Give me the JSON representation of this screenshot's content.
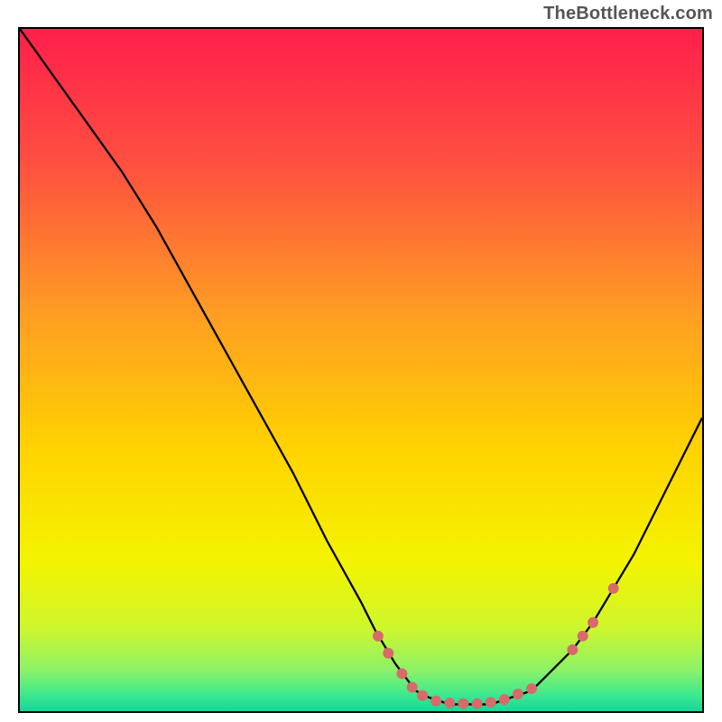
{
  "watermark": "TheBottleneck.com",
  "chart_data": {
    "type": "line",
    "title": "",
    "xlabel": "",
    "ylabel": "",
    "xlim": [
      0,
      100
    ],
    "ylim": [
      0,
      100
    ],
    "curve": [
      {
        "x": 0,
        "y": 100
      },
      {
        "x": 5,
        "y": 93
      },
      {
        "x": 10,
        "y": 86
      },
      {
        "x": 15,
        "y": 79
      },
      {
        "x": 20,
        "y": 71
      },
      {
        "x": 25,
        "y": 62
      },
      {
        "x": 30,
        "y": 53
      },
      {
        "x": 35,
        "y": 44
      },
      {
        "x": 40,
        "y": 35
      },
      {
        "x": 45,
        "y": 25
      },
      {
        "x": 50,
        "y": 16
      },
      {
        "x": 52,
        "y": 12
      },
      {
        "x": 55,
        "y": 7
      },
      {
        "x": 58,
        "y": 3
      },
      {
        "x": 60,
        "y": 2
      },
      {
        "x": 63,
        "y": 1
      },
      {
        "x": 66,
        "y": 1
      },
      {
        "x": 69,
        "y": 1
      },
      {
        "x": 72,
        "y": 2
      },
      {
        "x": 75,
        "y": 3
      },
      {
        "x": 78,
        "y": 6
      },
      {
        "x": 81,
        "y": 9
      },
      {
        "x": 84,
        "y": 13
      },
      {
        "x": 87,
        "y": 18
      },
      {
        "x": 90,
        "y": 23
      },
      {
        "x": 93,
        "y": 29
      },
      {
        "x": 96,
        "y": 35
      },
      {
        "x": 100,
        "y": 43
      }
    ],
    "markers": [
      {
        "x": 52.5,
        "y": 11
      },
      {
        "x": 54,
        "y": 8.5
      },
      {
        "x": 56,
        "y": 5.5
      },
      {
        "x": 57.5,
        "y": 3.5
      },
      {
        "x": 59,
        "y": 2.3
      },
      {
        "x": 61,
        "y": 1.5
      },
      {
        "x": 63,
        "y": 1.2
      },
      {
        "x": 65,
        "y": 1.1
      },
      {
        "x": 67,
        "y": 1.1
      },
      {
        "x": 69,
        "y": 1.3
      },
      {
        "x": 71,
        "y": 1.7
      },
      {
        "x": 73,
        "y": 2.5
      },
      {
        "x": 75,
        "y": 3.3
      },
      {
        "x": 81,
        "y": 9
      },
      {
        "x": 82.5,
        "y": 11
      },
      {
        "x": 84,
        "y": 13
      },
      {
        "x": 87,
        "y": 18
      }
    ],
    "gradient": {
      "orientation": "vertical",
      "stops": [
        {
          "offset": 0,
          "color": "#ff1f4b"
        },
        {
          "offset": 0.2,
          "color": "#ff5040"
        },
        {
          "offset": 0.42,
          "color": "#ff9e22"
        },
        {
          "offset": 0.62,
          "color": "#ffd400"
        },
        {
          "offset": 0.78,
          "color": "#f4f300"
        },
        {
          "offset": 0.88,
          "color": "#cdf62e"
        },
        {
          "offset": 0.94,
          "color": "#8cf268"
        },
        {
          "offset": 0.975,
          "color": "#3fe98e"
        },
        {
          "offset": 1.0,
          "color": "#14d79a"
        }
      ]
    },
    "marker_style": {
      "fill": "#d86a6a",
      "r": 6
    }
  }
}
